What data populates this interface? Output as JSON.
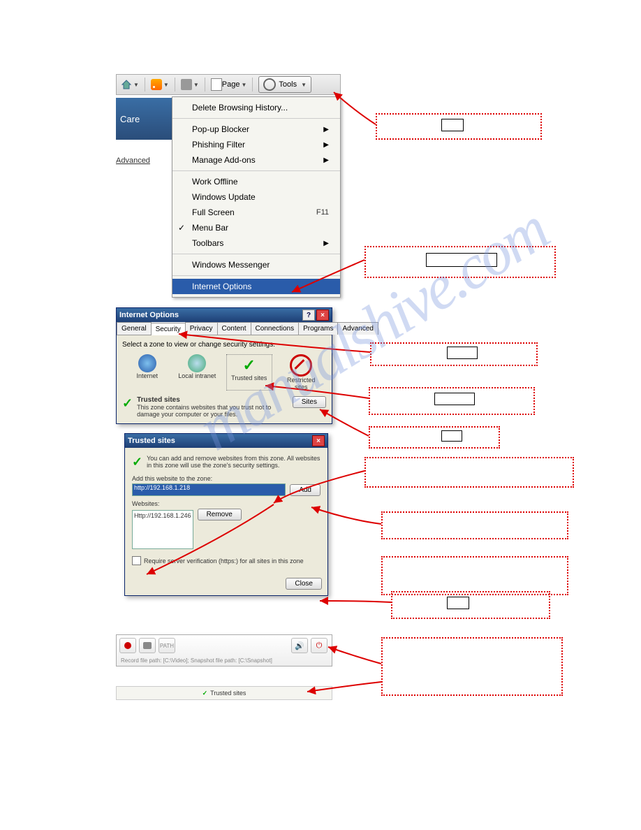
{
  "toolbar": {
    "page_label": "Page",
    "tools_label": "Tools"
  },
  "banner": {
    "title": "Care"
  },
  "advanced_link": "Advanced",
  "tools_menu": {
    "delete_history": "Delete Browsing History...",
    "popup": "Pop-up Blocker",
    "phishing": "Phishing Filter",
    "addons": "Manage Add-ons",
    "offline": "Work Offline",
    "update": "Windows Update",
    "fullscreen": "Full Screen",
    "fullscreen_key": "F11",
    "menubar": "Menu Bar",
    "toolbars": "Toolbars",
    "messenger": "Windows Messenger",
    "inetopts": "Internet Options"
  },
  "inetopts": {
    "title": "Internet Options",
    "tabs": {
      "general": "General",
      "security": "Security",
      "privacy": "Privacy",
      "content": "Content",
      "connections": "Connections",
      "programs": "Programs",
      "advanced": "Advanced"
    },
    "prompt": "Select a zone to view or change security settings.",
    "zones": {
      "internet": "Internet",
      "intranet": "Local intranet",
      "trusted": "Trusted sites",
      "restricted": "Restricted sites"
    },
    "trusted_title": "Trusted sites",
    "trusted_desc": "This zone contains websites that you trust not to damage your computer or your files.",
    "sites_btn": "Sites"
  },
  "trusted_dlg": {
    "title": "Trusted sites",
    "desc": "You can add and remove websites from this zone. All websites in this zone will use the zone's security settings.",
    "add_label": "Add this website to the zone:",
    "add_value": "http://192.168.1.218",
    "add_btn": "Add",
    "websites_label": "Websites:",
    "website_entry": "Http://192.168.1.246",
    "remove_btn": "Remove",
    "require_https": "Require server verification (https:) for all sites in this zone",
    "close_btn": "Close"
  },
  "recbar": {
    "path": "Record file path: [C:\\Video]; Snapshot file path: [C:\\Snapshot]"
  },
  "status": {
    "text": "Trusted sites"
  },
  "watermark": "manualshive.com"
}
